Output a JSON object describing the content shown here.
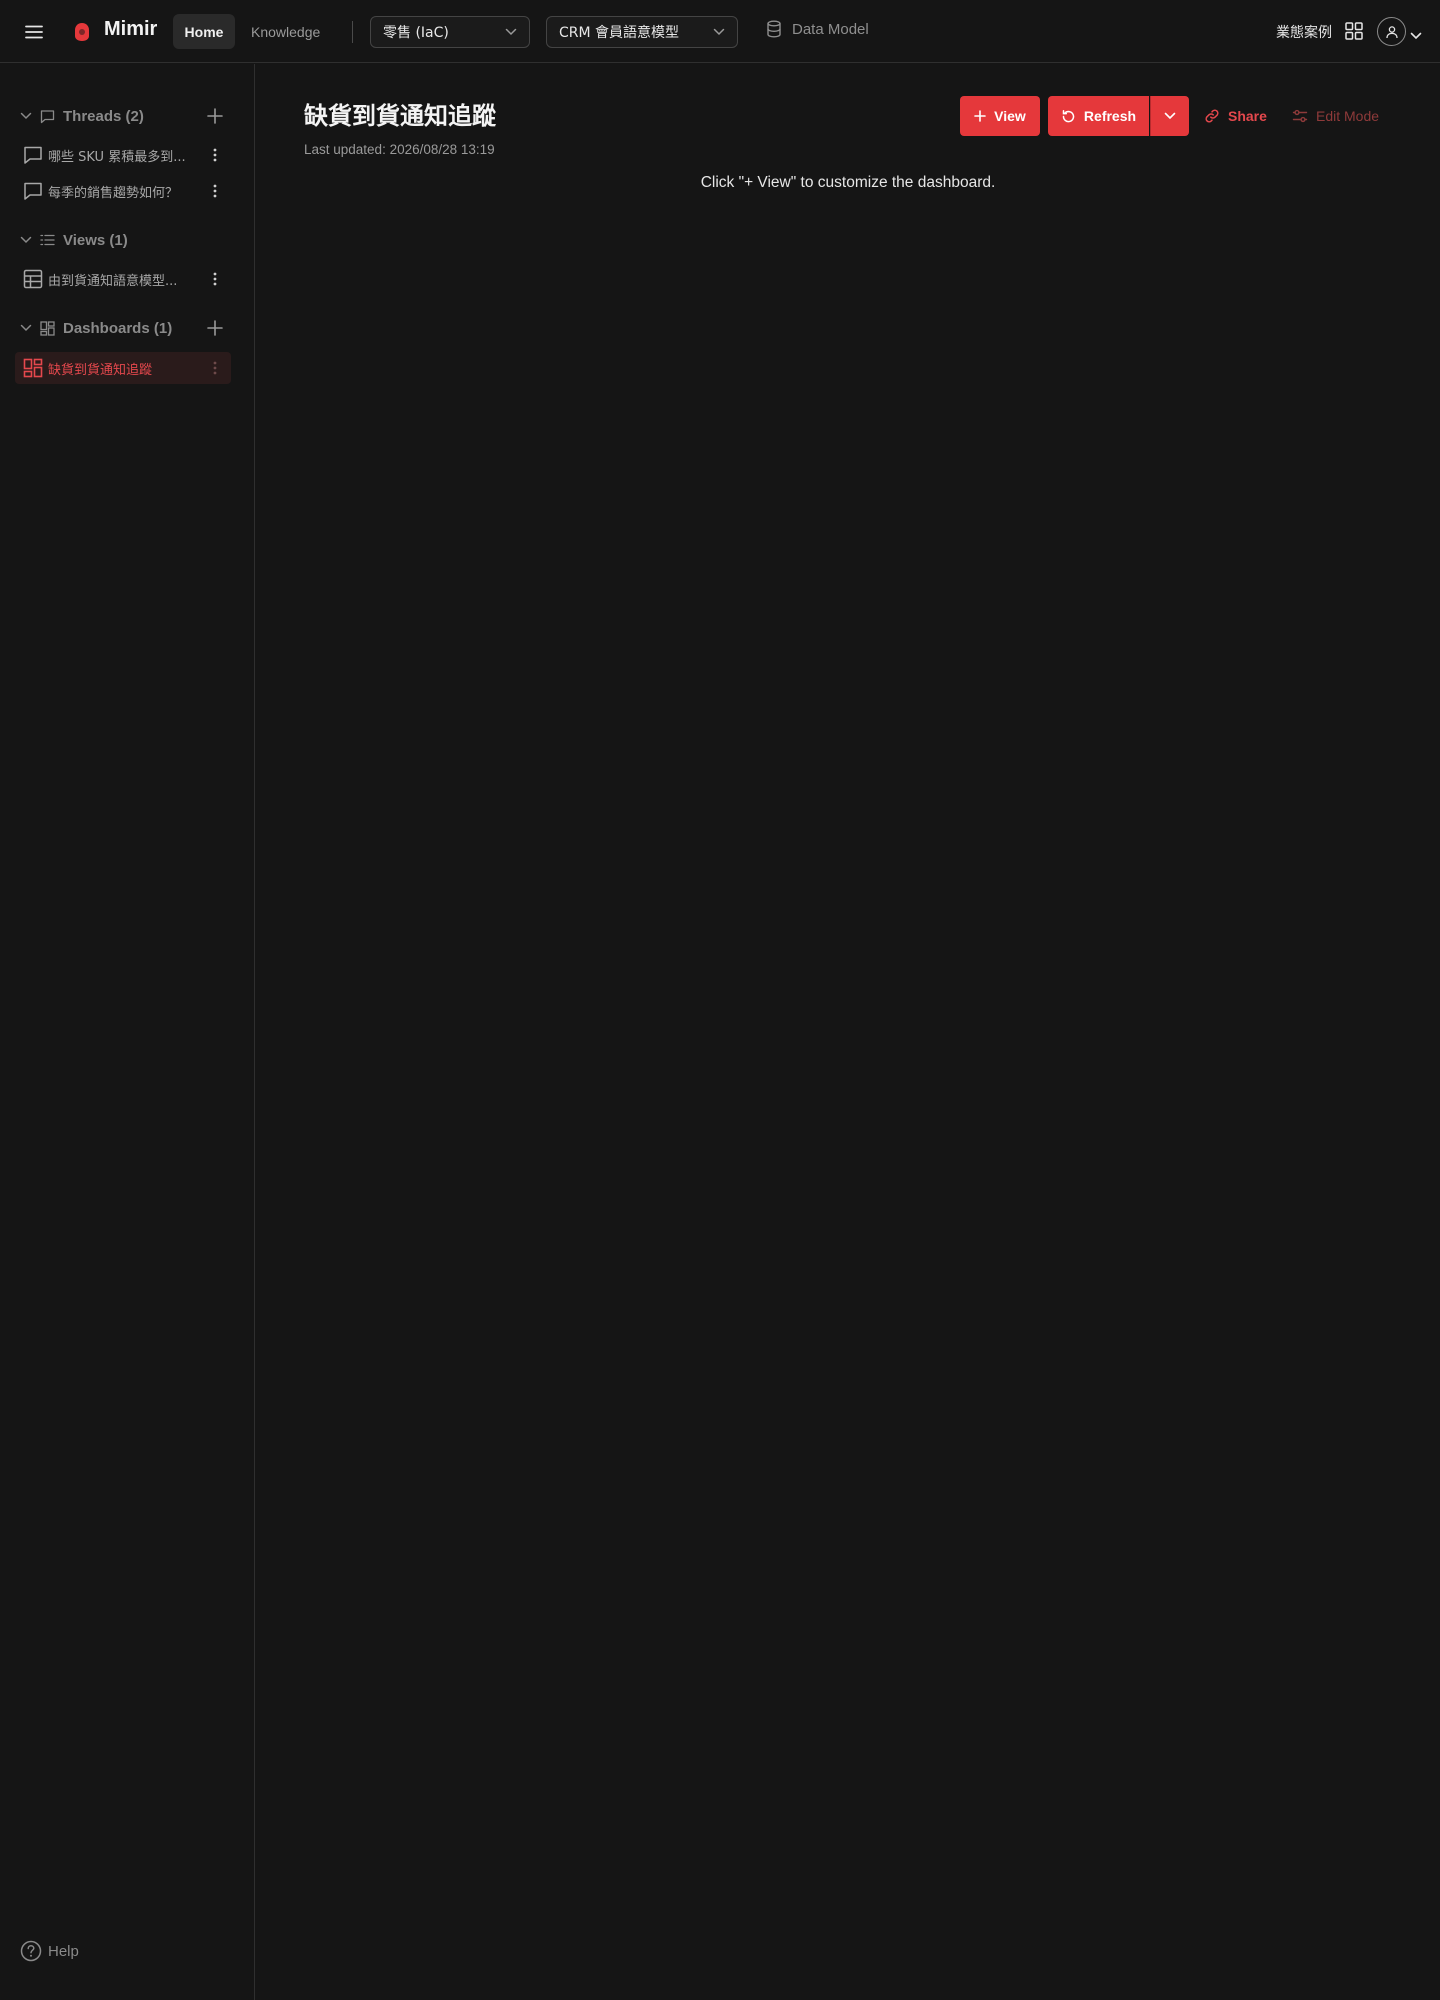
{
  "app": {
    "brand": "Mimir",
    "accent": "#e5383b"
  },
  "topbar": {
    "nav": {
      "home": "Home",
      "knowledge": "Knowledge"
    },
    "project_select": "零售 (IaC)",
    "model_select": "CRM 會員語意模型",
    "data_model": "Data Model",
    "cases": "業態案例",
    "icons": [
      "menu-icon",
      "logo-icon",
      "chevron-down-icon",
      "database-icon",
      "apps-grid-icon",
      "user-icon"
    ]
  },
  "sidebar": {
    "threads": {
      "title": "Threads (2)",
      "items": [
        {
          "label": "哪些 SKU 累積最多到..."
        },
        {
          "label": "每季的銷售趨勢如何？"
        }
      ]
    },
    "views": {
      "title": "Views (1)",
      "items": [
        {
          "label": "由到貨通知語意模型..."
        }
      ]
    },
    "dashboards": {
      "title": "Dashboards (1)",
      "items": [
        {
          "label": "缺貨到貨通知追蹤",
          "active": true
        }
      ]
    },
    "help": "Help"
  },
  "main": {
    "title": "缺貨到貨通知追蹤",
    "last_updated": "Last updated: 2026/08/28 13:19",
    "empty_message": "Click \"+ View\" to customize the dashboard.",
    "buttons": {
      "view": "View",
      "refresh": "Refresh",
      "share": "Share",
      "edit_mode": "Edit Mode"
    }
  }
}
